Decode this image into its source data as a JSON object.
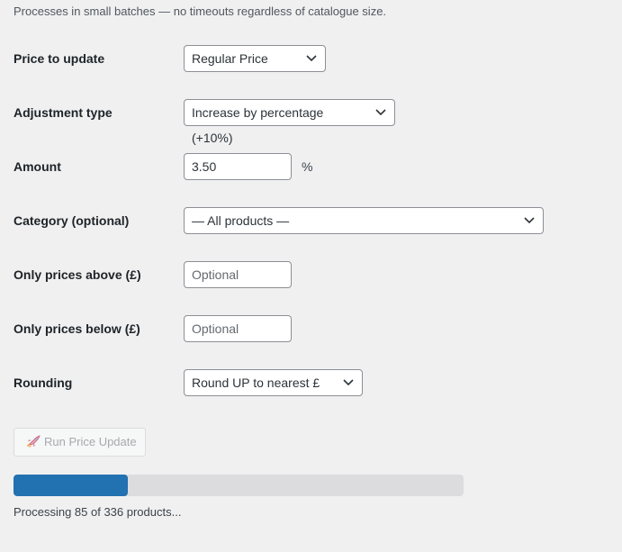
{
  "intro": "Processes in small batches — no timeouts regardless of catalogue size.",
  "fields": {
    "price_to_update": {
      "label": "Price to update",
      "value": "Regular Price"
    },
    "adjustment_type": {
      "label": "Adjustment type",
      "value": "Increase by percentage (+10%)"
    },
    "amount": {
      "label": "Amount",
      "value": "3.50",
      "suffix": "%"
    },
    "category": {
      "label": "Category (optional)",
      "value": "— All products —"
    },
    "price_above": {
      "label": "Only prices above (£)",
      "placeholder": "Optional",
      "value": ""
    },
    "price_below": {
      "label": "Only prices below (£)",
      "placeholder": "Optional",
      "value": ""
    },
    "rounding": {
      "label": "Rounding",
      "value": "Round UP to nearest £"
    }
  },
  "run_button": {
    "label": "Run Price Update",
    "icon": "rocket-icon",
    "disabled": true
  },
  "progress": {
    "processed": 85,
    "total": 336,
    "fraction": 0.253,
    "color": "#2271b1"
  },
  "status_text": "Processing 85 of 336 products..."
}
